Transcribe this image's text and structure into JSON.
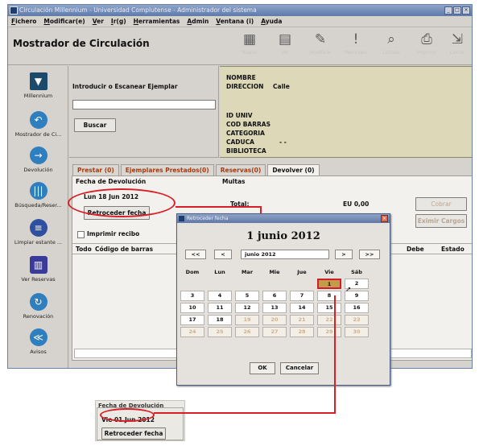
{
  "window": {
    "title": "Circulación Millennium - Universidad Complutense - Administrador del sistema",
    "buttons": [
      "_",
      "□",
      "×"
    ]
  },
  "menu": [
    "Fichero",
    "Modificar(e)",
    "Ver",
    "Ir(g)",
    "Herramientas",
    "Admin",
    "Ventana (i)",
    "Ayuda"
  ],
  "app_title": "Mostrador de Circulación",
  "toolbar": [
    {
      "label": "Nuevo",
      "icon": "new-record-icon",
      "glyph": "▦"
    },
    {
      "label": "Ver",
      "icon": "view-icon",
      "glyph": "▤"
    },
    {
      "label": "Modificar",
      "icon": "edit-icon",
      "glyph": "✎"
    },
    {
      "label": "Mensajes",
      "icon": "message-icon",
      "glyph": "!"
    },
    {
      "label": "Listado",
      "icon": "search-icon",
      "glyph": "⌕"
    },
    {
      "label": "Imprimir",
      "icon": "print-icon",
      "glyph": "⎙"
    },
    {
      "label": "Cerrar",
      "icon": "close-icon",
      "glyph": "⇲"
    }
  ],
  "sidebar": [
    {
      "label": "Millennium",
      "icon": "millennium-logo-icon",
      "color": "#1b4a6b",
      "glyph": "▼"
    },
    {
      "label": "Mostrador de Ci...",
      "icon": "checkout-arrow-icon",
      "color": "#2f7fbf",
      "glyph": "↶"
    },
    {
      "label": "Devolución",
      "icon": "return-arrow-icon",
      "color": "#2f7fbf",
      "glyph": "→"
    },
    {
      "label": "Búsqueda/Reser...",
      "icon": "books-icon",
      "color": "#2f7fbf",
      "glyph": "|||"
    },
    {
      "label": "Limpiar estante ...",
      "icon": "shelf-icon",
      "color": "#2f4f9f",
      "glyph": "≡"
    },
    {
      "label": "Ver Reservas",
      "icon": "reserve-books-icon",
      "color": "#3a3a9a",
      "glyph": "▥"
    },
    {
      "label": "Renovación",
      "icon": "renew-icon",
      "color": "#2f7fbf",
      "glyph": "↻"
    },
    {
      "label": "Avisos",
      "icon": "notice-icon",
      "color": "#2f7fbf",
      "glyph": "≪"
    }
  ],
  "form": {
    "scan_label": "Introducir o Escanear Ejemplar",
    "scan_value": "",
    "search_button": "Buscar"
  },
  "patron": {
    "nombre": "NOMBRE",
    "direccion": "DIRECCION",
    "direccion_value": "Calle",
    "id_univ": "ID UNIV",
    "cod_barras": "COD BARRAS",
    "categoria": "CATEGORIA",
    "caduca": "CADUCA",
    "caduca_value": "- -",
    "biblioteca": "BIBLIOTECA"
  },
  "tabs": [
    "Prestar (0)",
    "Ejemplares Prestados(0)",
    "Reservas(0)",
    "Devolver (0)"
  ],
  "return_panel": {
    "date_group": "Fecha de Devolución",
    "date": "Lun 18 Jun 2012",
    "back_date_button": "Retroceder fecha",
    "print_receipt": "Imprimir recibo"
  },
  "fines": {
    "group": "Multas",
    "total_label": "Total:",
    "total_value": "EU 0,00",
    "cobrar": "Cobrar",
    "eximir": "Eximir Cargos"
  },
  "list_columns": [
    "Todo",
    "Código de barras"
  ],
  "right_columns": [
    "Debe",
    "Estado"
  ],
  "dialog": {
    "title": "Retroceder fecha",
    "heading": "1 junio 2012",
    "nav": [
      "<<",
      "<",
      ">",
      ">>"
    ],
    "month_field": "junio 2012",
    "weekdays": [
      "Dom",
      "Lun",
      "Mar",
      "Mie",
      "Jue",
      "Vie",
      "Sáb"
    ],
    "days": [
      [
        "",
        "",
        "",
        "",
        "",
        "1",
        "2"
      ],
      [
        "3",
        "4",
        "5",
        "6",
        "7",
        "8",
        "9"
      ],
      [
        "10",
        "11",
        "12",
        "13",
        "14",
        "15",
        "16"
      ],
      [
        "17",
        "18",
        "19",
        "20",
        "21",
        "22",
        "23"
      ],
      [
        "24",
        "25",
        "26",
        "27",
        "28",
        "29",
        "30"
      ]
    ],
    "selected": "1",
    "ok": "OK",
    "cancel": "Cancelar"
  },
  "inset": {
    "group": "Fecha de Devolución",
    "date": "Vie 01 Jun 2012",
    "button": "Retroceder fecha"
  },
  "colors": {
    "highlight": "#d81f26",
    "selected_day": "#c69a4b",
    "patron_bg": "#ddd9b8"
  }
}
